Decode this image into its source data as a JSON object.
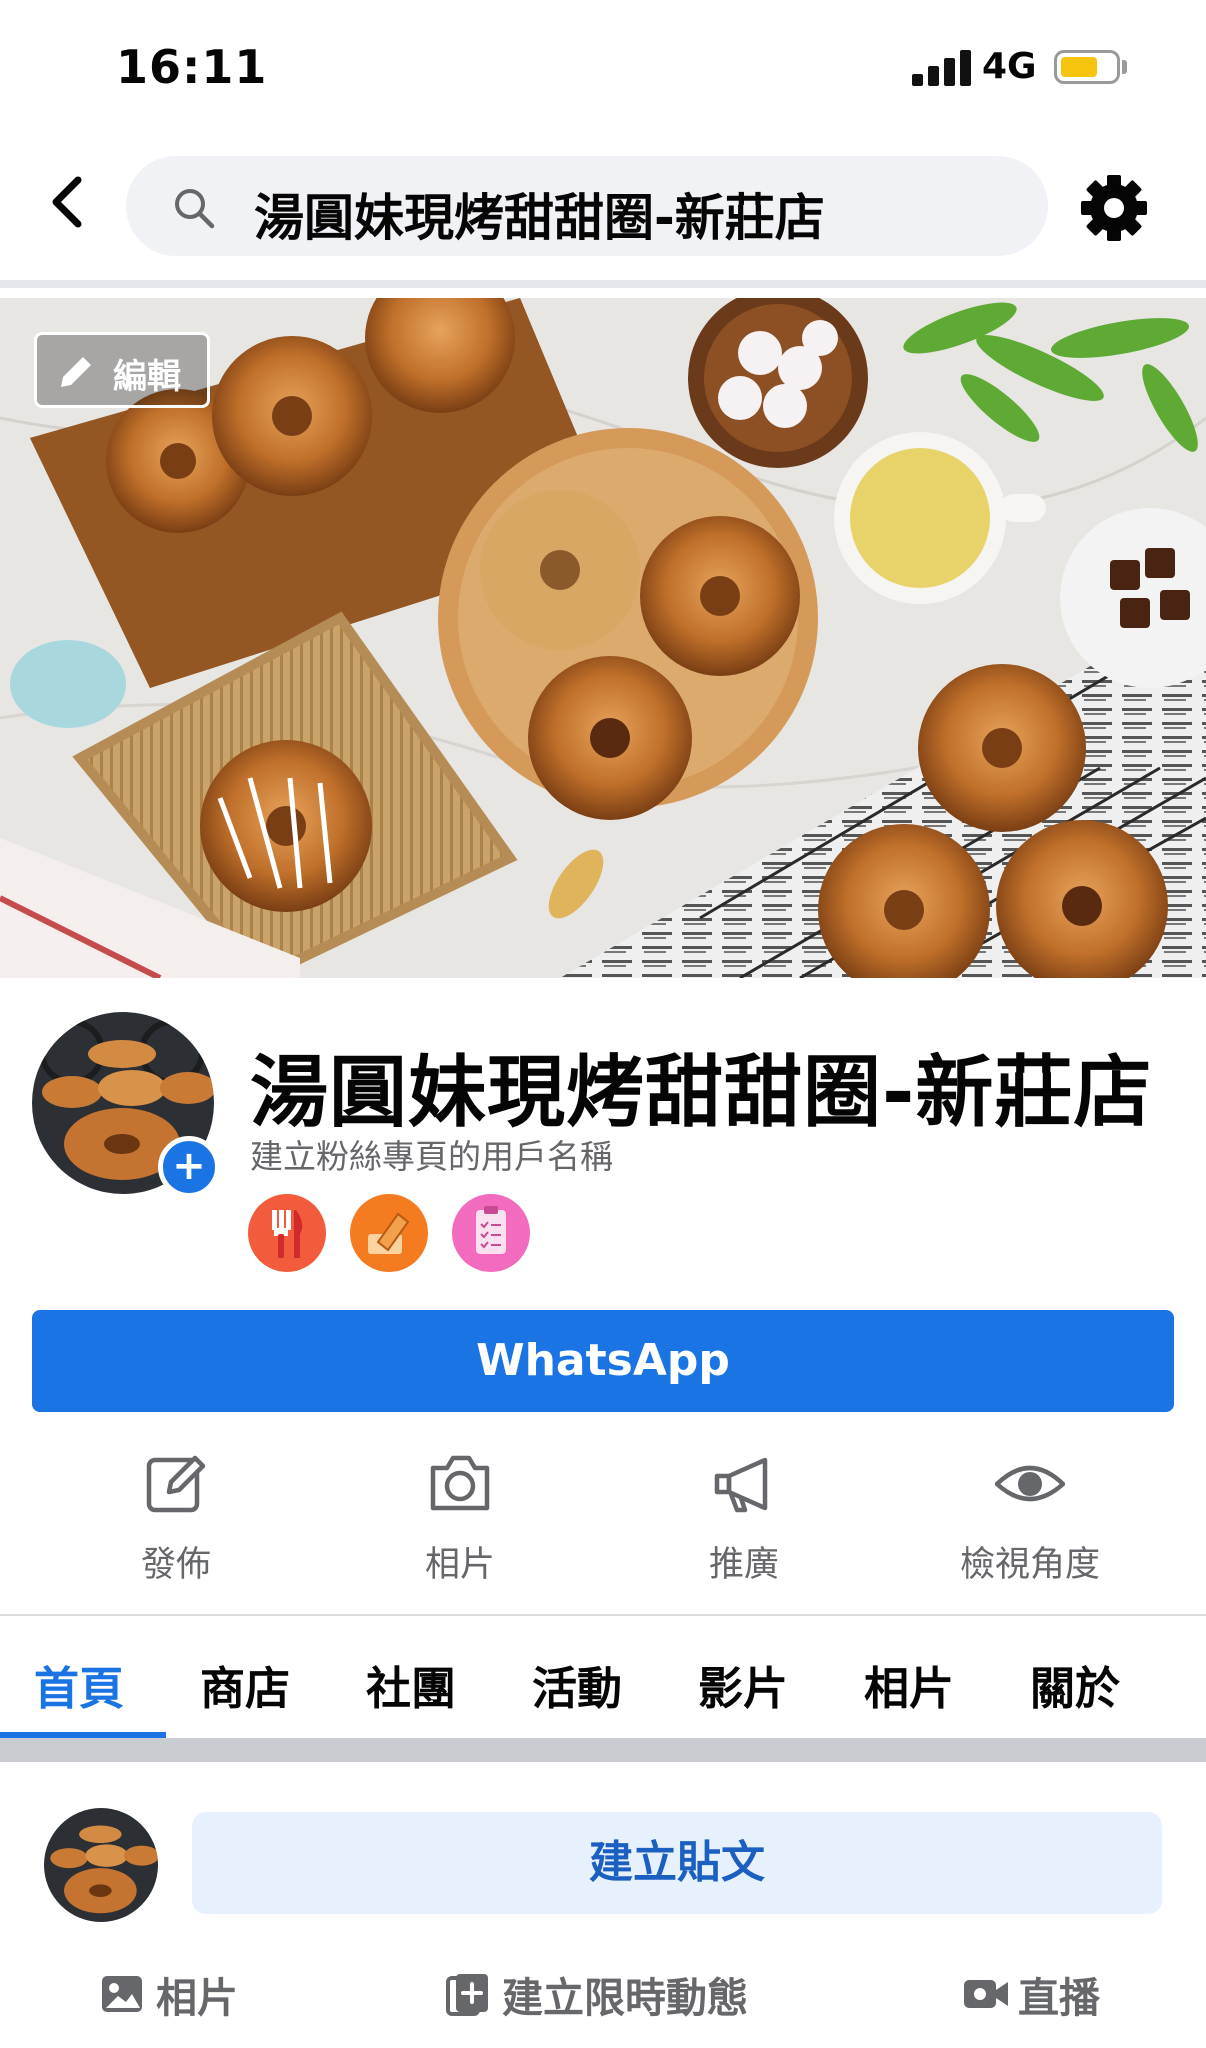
{
  "status_bar": {
    "time": "16:11",
    "network": "4G",
    "battery_level": 0.7
  },
  "nav": {
    "search_text": "湯圓妹現烤甜甜圈-新莊店"
  },
  "cover": {
    "edit_label": "編輯"
  },
  "profile": {
    "name": "湯圓妹現烤甜甜圈-新莊店",
    "username_hint": "建立粉絲專頁的用戶名稱",
    "category_badges": [
      "restaurant-icon",
      "edit-pencil-icon",
      "clipboard-checklist-icon"
    ]
  },
  "cta": {
    "whatsapp_label": "WhatsApp"
  },
  "actions": [
    {
      "label": "發佈",
      "icon": "compose-icon"
    },
    {
      "label": "相片",
      "icon": "camera-icon"
    },
    {
      "label": "推廣",
      "icon": "megaphone-icon"
    },
    {
      "label": "檢視角度",
      "icon": "eye-icon"
    }
  ],
  "tabs": [
    {
      "label": "首頁",
      "active": true
    },
    {
      "label": "商店"
    },
    {
      "label": "社團"
    },
    {
      "label": "活動"
    },
    {
      "label": "影片"
    },
    {
      "label": "相片"
    },
    {
      "label": "關於"
    }
  ],
  "composer": {
    "create_post_label": "建立貼文",
    "bottom_actions": [
      {
        "label": "相片",
        "icon": "photo-icon"
      },
      {
        "label": "建立限時動態",
        "icon": "story-add-icon"
      },
      {
        "label": "直播",
        "icon": "live-video-icon"
      }
    ]
  },
  "colors": {
    "accent": "#1b74e4",
    "secondary_text": "#65676b",
    "search_bg": "#f0f2f5"
  }
}
